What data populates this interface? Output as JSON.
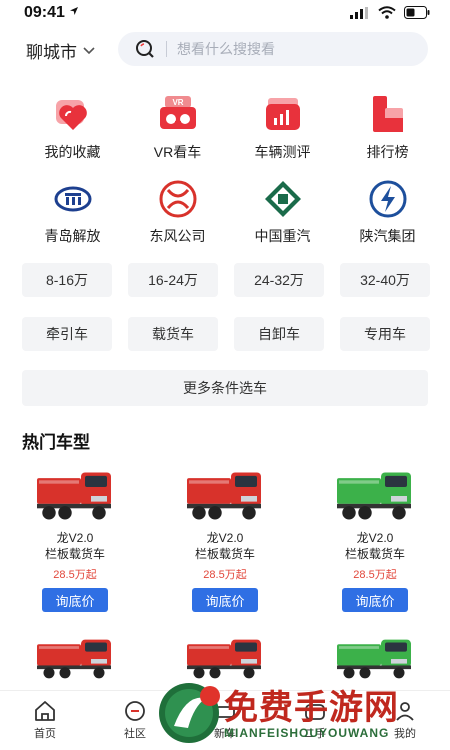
{
  "status": {
    "time": "09:41"
  },
  "header": {
    "city": "聊城市",
    "search_placeholder": "想看什么搜搜看"
  },
  "shortcuts": [
    {
      "label": "我的收藏",
      "icon": "heart-stack-icon"
    },
    {
      "label": "VR看车",
      "icon": "vr-goggles-icon"
    },
    {
      "label": "车辆测评",
      "icon": "bar-chart-icon"
    },
    {
      "label": "排行榜",
      "icon": "ranking-icon"
    }
  ],
  "brands": [
    {
      "label": "青岛解放",
      "icon": "faw-logo-icon"
    },
    {
      "label": "东风公司",
      "icon": "dongfeng-logo-icon"
    },
    {
      "label": "中国重汽",
      "icon": "sinotruk-logo-icon"
    },
    {
      "label": "陕汽集团",
      "icon": "shacman-logo-icon"
    }
  ],
  "price_chips": [
    "8-16万",
    "16-24万",
    "24-32万",
    "32-40万"
  ],
  "type_chips": [
    "牵引车",
    "载货车",
    "自卸车",
    "专用车"
  ],
  "more_button": "更多条件选车",
  "hot_title": "热门车型",
  "hot_models": [
    {
      "name1": "龙V2.0",
      "name2": "栏板载货车",
      "price": "28.5万起",
      "button": "询底价",
      "color": "#d8322b"
    },
    {
      "name1": "龙V2.0",
      "name2": "栏板载货车",
      "price": "28.5万起",
      "button": "询底价",
      "color": "#d8322b"
    },
    {
      "name1": "龙V2.0",
      "name2": "栏板载货车",
      "price": "28.5万起",
      "button": "询底价",
      "color": "#3cb14a"
    }
  ],
  "tabs": [
    {
      "label": "首页",
      "icon": "home-icon"
    },
    {
      "label": "社区",
      "icon": "community-icon"
    },
    {
      "label": "新车",
      "icon": "new-car-icon"
    },
    {
      "label": "二手",
      "icon": "used-car-icon"
    },
    {
      "label": "我的",
      "icon": "profile-icon"
    }
  ],
  "watermark": {
    "text": "免费手游网",
    "sub": "MIANFEISHOUYOUWANG"
  }
}
